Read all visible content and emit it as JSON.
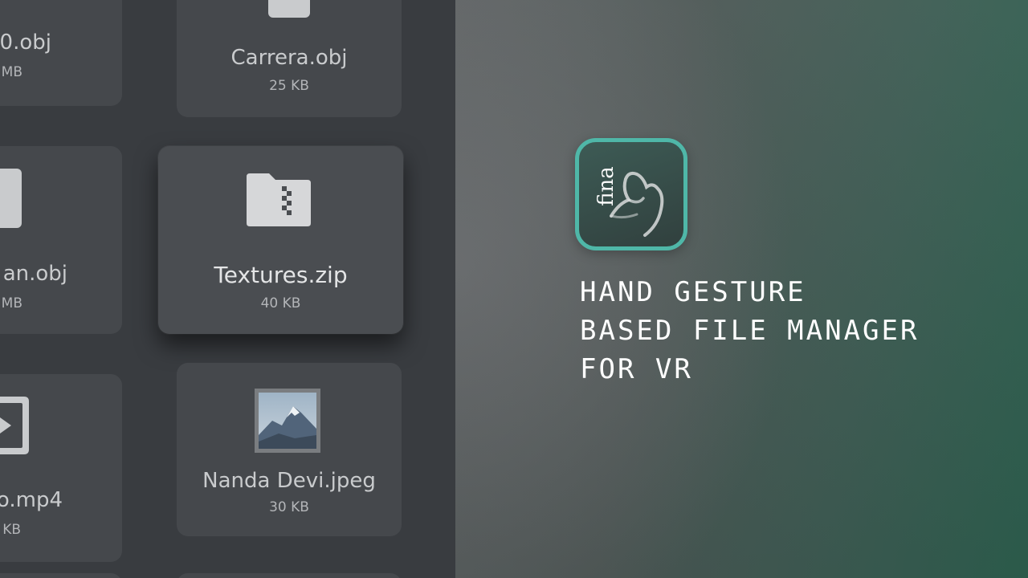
{
  "files": [
    {
      "name": "0.obj",
      "size": "MB",
      "icon": "file-icon"
    },
    {
      "name": "Carrera.obj",
      "size": "25 KB",
      "icon": "file-icon"
    },
    {
      "name": "an.obj",
      "size": "MB",
      "icon": "file-icon"
    },
    {
      "name": "Textures.zip",
      "size": "40 KB",
      "icon": "zip-folder-icon"
    },
    {
      "name": "o.mp4",
      "size": "KB",
      "icon": "video-icon"
    },
    {
      "name": "Nanda Devi.jpeg",
      "size": "30 KB",
      "icon": "image-thumbnail-icon"
    }
  ],
  "brand": {
    "logo_text": "fina",
    "tagline_lines": [
      "HAND GESTURE",
      "BASED FILE MANAGER",
      "FOR VR"
    ]
  },
  "colors": {
    "accent": "#4fb7a8",
    "panel": "#393c40",
    "tile": "#45484c"
  }
}
